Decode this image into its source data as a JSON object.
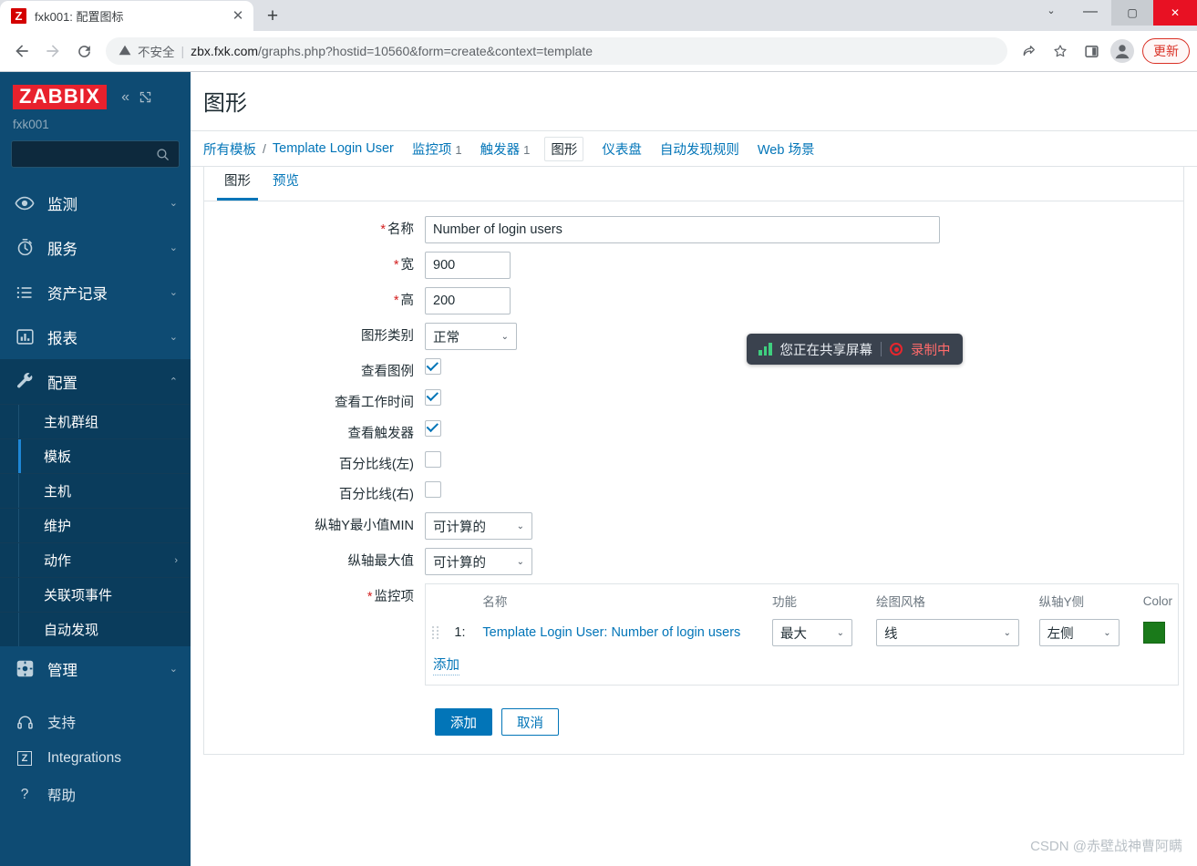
{
  "browser": {
    "tab": {
      "title": "fxk001: 配置图标",
      "favicon_letter": "Z",
      "close_label": "✕"
    },
    "newtab_label": "+",
    "window": {
      "tab_list_label": "⌄",
      "minimize_label": "—",
      "maximize_label": "▢",
      "close_label": "✕"
    },
    "nav": {
      "back_label": "←",
      "forward_label": "→",
      "reload_label": "⟳"
    },
    "omnibox": {
      "warning_icon": "warning-triangle-icon",
      "security_text": "不安全",
      "separator": "|",
      "url_host": "zbx.fxk.com",
      "url_path": "/graphs.php?hostid=10560&form=create&context=template"
    },
    "actions": {
      "share_label": "share-icon",
      "bookmark_label": "star-icon",
      "sidepanel_label": "side-panel-icon",
      "profile_label": "profile-icon",
      "update_label": "更新"
    }
  },
  "sidebar": {
    "logo": "ZABBIX",
    "collapse_label": "«",
    "expand_label": "expand-icon",
    "hostname": "fxk001",
    "search_placeholder": "",
    "menu": [
      {
        "label": "监测",
        "icon": "eye-icon",
        "arrow": "⌄",
        "active": false
      },
      {
        "label": "服务",
        "icon": "clock-icon",
        "arrow": "⌄",
        "active": false
      },
      {
        "label": "资产记录",
        "icon": "list-icon",
        "arrow": "⌄",
        "active": false
      },
      {
        "label": "报表",
        "icon": "chart-icon",
        "arrow": "⌄",
        "active": false
      },
      {
        "label": "配置",
        "icon": "wrench-icon",
        "arrow": "⌃",
        "active": true
      }
    ],
    "submenu": [
      {
        "label": "主机群组",
        "current": false,
        "arrow": ""
      },
      {
        "label": "模板",
        "current": true,
        "arrow": ""
      },
      {
        "label": "主机",
        "current": false,
        "arrow": ""
      },
      {
        "label": "维护",
        "current": false,
        "arrow": ""
      },
      {
        "label": "动作",
        "current": false,
        "arrow": "›"
      },
      {
        "label": "关联项事件",
        "current": false,
        "arrow": ""
      },
      {
        "label": "自动发现",
        "current": false,
        "arrow": ""
      }
    ],
    "admin": {
      "label": "管理",
      "icon": "gear-icon",
      "arrow": "⌄"
    },
    "bottom": [
      {
        "label": "支持",
        "icon": "headset-icon"
      },
      {
        "label": "Integrations",
        "icon": "zabbix-square-icon"
      },
      {
        "label": "帮助",
        "icon": "question-icon"
      }
    ]
  },
  "page": {
    "title": "图形",
    "breadcrumb": {
      "root": "所有模板",
      "sep": "/",
      "template": "Template Login User"
    },
    "nav_items": [
      {
        "label": "监控项",
        "count": "1",
        "selected": false
      },
      {
        "label": "触发器",
        "count": "1",
        "selected": false
      },
      {
        "label": "图形",
        "count": "",
        "selected": true
      },
      {
        "label": "仪表盘",
        "count": "",
        "selected": false
      },
      {
        "label": "自动发现规则",
        "count": "",
        "selected": false
      },
      {
        "label": "Web 场景",
        "count": "",
        "selected": false
      }
    ],
    "form_tabs": [
      {
        "label": "图形",
        "active": true
      },
      {
        "label": "预览",
        "active": false
      }
    ]
  },
  "form": {
    "name": {
      "label": "名称",
      "required": true,
      "value": "Number of login users"
    },
    "width": {
      "label": "宽",
      "required": true,
      "value": "900"
    },
    "height": {
      "label": "高",
      "required": true,
      "value": "200"
    },
    "graph_type": {
      "label": "图形类别",
      "required": false,
      "value": "正常",
      "caret": "⌄"
    },
    "show_legend": {
      "label": "查看图例",
      "checked": true
    },
    "show_working_time": {
      "label": "查看工作时间",
      "checked": true
    },
    "show_triggers": {
      "label": "查看触发器",
      "checked": true
    },
    "percentile_left": {
      "label": "百分比线(左)",
      "checked": false
    },
    "percentile_right": {
      "label": "百分比线(右)",
      "checked": false
    },
    "ymin": {
      "label": "纵轴Y最小值MIN",
      "value": "可计算的",
      "caret": "⌄"
    },
    "ymax": {
      "label": "纵轴最大值",
      "value": "可计算的",
      "caret": "⌄"
    },
    "items": {
      "label": "监控项",
      "required": true,
      "headers": {
        "name": "名称",
        "function": "功能",
        "draw_style": "绘图风格",
        "yaxis_side": "纵轴Y侧",
        "color": "Color"
      },
      "rows": [
        {
          "index": "1:",
          "name": "Template Login User: Number of login users",
          "function": "最大",
          "draw_style": "线",
          "yaxis_side": "左侧",
          "color": "#1a7a1a",
          "caret": "⌄"
        }
      ],
      "add_label": "添加"
    },
    "buttons": {
      "submit": "添加",
      "cancel": "取消"
    }
  },
  "overlay": {
    "share_toast": {
      "bars_icon": "signal-bars-icon",
      "text": "您正在共享屏幕",
      "separator": "|",
      "record_icon": "record-dot-icon",
      "record_text": "录制中"
    },
    "watermark": "CSDN @赤壁战神曹阿瞒"
  }
}
